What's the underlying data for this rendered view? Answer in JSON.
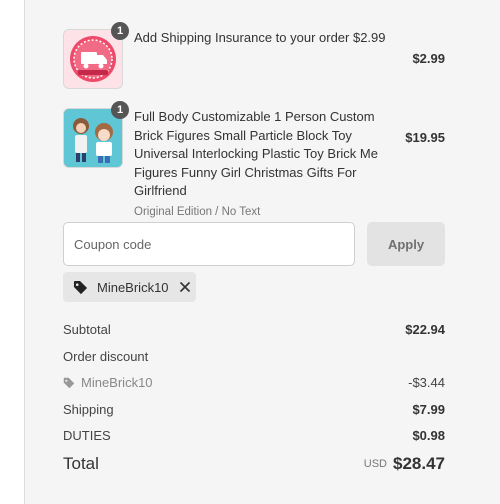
{
  "line_items": [
    {
      "quantity": "1",
      "title": "Add Shipping Insurance to your order $2.99",
      "price": "$2.99",
      "thumbnail_icon": "shipping-insurance-badge-icon"
    },
    {
      "quantity": "1",
      "title": "Full Body Customizable 1 Person Custom Brick Figures Small Particle Block Toy Universal Interlocking Plastic Toy Brick Me Figures Funny Girl Christmas Gifts For Girlfriend",
      "variant": "Original Edition / No Text",
      "price": "$19.95",
      "thumbnail_icon": "brick-figure-product-icon"
    }
  ],
  "coupon": {
    "placeholder": "Coupon code",
    "apply_label": "Apply",
    "applied_code": "MineBrick10"
  },
  "summary": {
    "subtotal_label": "Subtotal",
    "subtotal_value": "$22.94",
    "order_discount_label": "Order discount",
    "discount_code": "MineBrick10",
    "discount_value": "-$3.44",
    "shipping_label": "Shipping",
    "shipping_value": "$7.99",
    "duties_label": "DUTIES",
    "duties_value": "$0.98",
    "total_label": "Total",
    "currency": "USD",
    "total_value": "$28.47"
  },
  "colors": {
    "panel_background": "#f5f5f5",
    "badge": "#555555",
    "apply_button": "#e3e3e3",
    "chip": "#e6e6e6"
  }
}
